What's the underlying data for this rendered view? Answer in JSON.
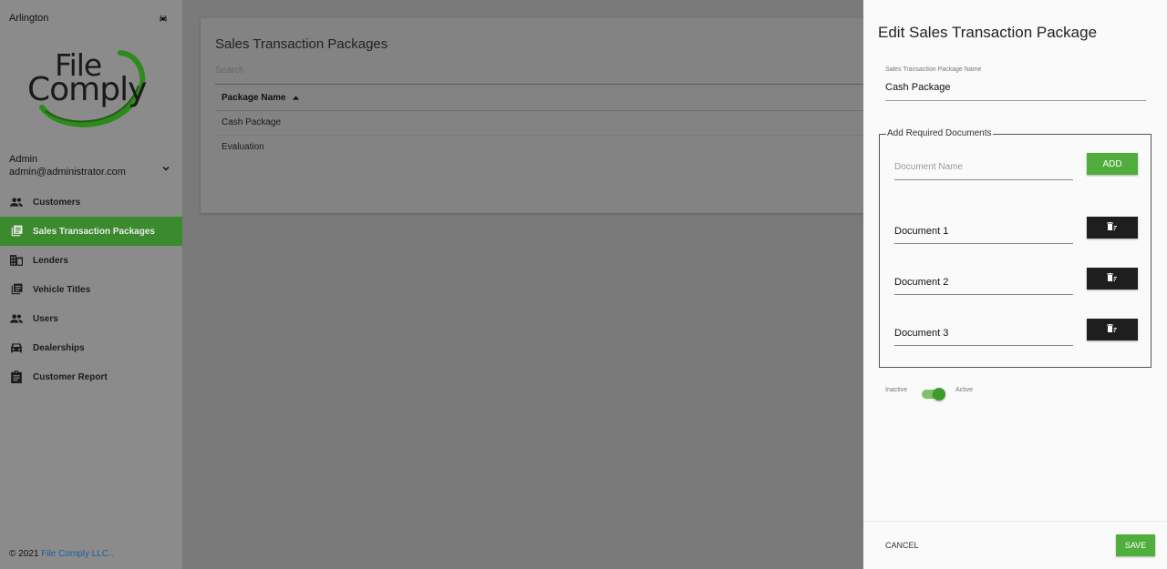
{
  "sidebar": {
    "location": "Arlington",
    "logo": {
      "line1": "File",
      "line2": "Comply"
    },
    "user": {
      "name": "Admin",
      "email": "admin@administrator.com"
    },
    "nav": [
      {
        "label": "Customers",
        "icon": "people-icon",
        "active": false
      },
      {
        "label": "Sales Transaction Packages",
        "icon": "article-icon",
        "active": true
      },
      {
        "label": "Lenders",
        "icon": "building-icon",
        "active": false
      },
      {
        "label": "Vehicle Titles",
        "icon": "article-icon",
        "active": false
      },
      {
        "label": "Users",
        "icon": "people-icon",
        "active": false
      },
      {
        "label": "Dealerships",
        "icon": "car-icon",
        "active": false
      },
      {
        "label": "Customer Report",
        "icon": "clipboard-icon",
        "active": false
      }
    ],
    "footer": {
      "prefix": "© 2021 ",
      "link": "File Comply LLC.."
    }
  },
  "main": {
    "title": "Sales Transaction Packages",
    "search_placeholder": "Search",
    "column_header": "Package Name",
    "rows": [
      "Cash Package",
      "Evaluation"
    ]
  },
  "drawer": {
    "title": "Edit Sales Transaction Package",
    "name_label": "Sales Transaction Package Name",
    "name_value": "Cash Package",
    "docs_legend": "Add Required Documents",
    "doc_placeholder": "Document Name",
    "add_label": "ADD",
    "documents": [
      "Document 1",
      "Document 2",
      "Document 3"
    ],
    "toggle": {
      "off_label": "Inactive",
      "on_label": "Active",
      "active": true
    },
    "cancel_label": "CANCEL",
    "save_label": "SAVE"
  },
  "colors": {
    "accent": "#4fae3c",
    "active_nav": "#3b8a2e",
    "delete_btn": "#1e1e1e"
  }
}
